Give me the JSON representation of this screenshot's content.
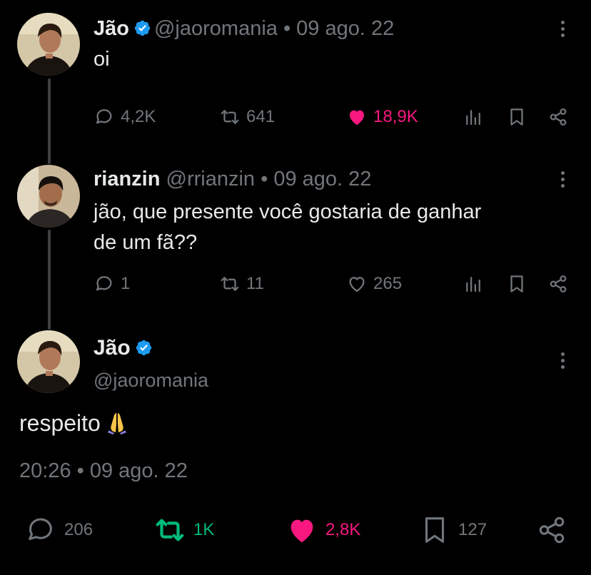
{
  "colors": {
    "background": "#000000",
    "text": "#e7e9ea",
    "muted": "#71767b",
    "like": "#f91880",
    "retweet": "#00ba7c",
    "verified": "#1d9bf0"
  },
  "tweet1": {
    "name": "Jão",
    "handle_date": "@jaoromania • 09 ago. 22",
    "text": "oi",
    "replies": "4,2K",
    "retweets": "641",
    "likes": "18,9K"
  },
  "tweet2": {
    "name": "rianzin",
    "handle_date": "@rrianzin • 09 ago. 22",
    "text_line1": "jão, que presente você gostaria de ganhar",
    "text_line2": "de um fã??",
    "replies": "1",
    "retweets": "11",
    "likes": "265"
  },
  "main_tweet": {
    "name": "Jão",
    "handle": "@jaoromania",
    "text": "respeito",
    "emoji": "folded-hands",
    "timestamp": "20:26 • 09 ago. 22",
    "replies": "206",
    "retweets": "1K",
    "likes": "2,8K",
    "bookmarks": "127"
  },
  "icons": [
    "reply-icon",
    "retweet-icon",
    "like-icon",
    "views-icon",
    "bookmark-icon",
    "share-icon",
    "more-icon",
    "verified-icon"
  ]
}
